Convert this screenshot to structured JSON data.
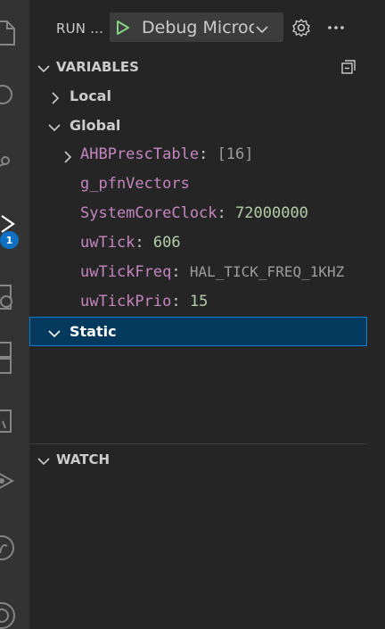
{
  "activity_bar": {
    "icons": [
      "explorer-icon",
      "search-icon",
      "source-control-icon",
      "run-debug-icon",
      "remote-explorer-icon",
      "extensions-icon",
      "testing-icon",
      "live-share-icon",
      "github-icon",
      "accounts-icon"
    ],
    "debug_badge": "1"
  },
  "header": {
    "run_label": "RUN ...",
    "config_name": "Debug Microcontroller",
    "accent_color": "#89d185"
  },
  "variables": {
    "title": "VARIABLES",
    "scopes": {
      "local": "Local",
      "global": "Global",
      "static": "Static"
    },
    "global_items": [
      {
        "name": "AHBPrescTable",
        "colon": ":",
        "value": "[16]",
        "expandable": true
      },
      {
        "name": "g_pfnVectors",
        "colon": "",
        "value": "",
        "expandable": false
      },
      {
        "name": "SystemCoreClock",
        "colon": ":",
        "value": "72000000",
        "expandable": false
      },
      {
        "name": "uwTick",
        "colon": ":",
        "value": "606",
        "expandable": false
      },
      {
        "name": "uwTickFreq",
        "colon": ":",
        "value": "HAL_TICK_FREQ_1KHZ",
        "expandable": false
      },
      {
        "name": "uwTickPrio",
        "colon": ":",
        "value": "15",
        "expandable": false
      }
    ]
  },
  "watch": {
    "title": "WATCH"
  }
}
